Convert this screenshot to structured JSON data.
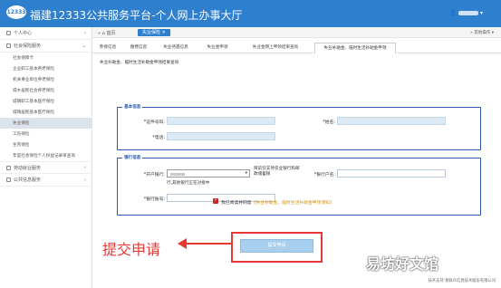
{
  "header": {
    "logo": "12333",
    "title": "福建12333公共服务平台-个人网上办事大厅",
    "user_caret": "▾"
  },
  "sidebar": {
    "groups": [
      {
        "label": "个人中心",
        "icon": "person-icon"
      },
      {
        "label": "社会保险服务",
        "icon": "shield-icon"
      }
    ],
    "items": [
      {
        "label": "社会保障卡"
      },
      {
        "label": "企业职工基本养老保险"
      },
      {
        "label": "机关事业单位养老保险"
      },
      {
        "label": "城乡居民社会养老保险"
      },
      {
        "label": "城镇职工基本医疗保险"
      },
      {
        "label": "城镇居民基本医疗保险"
      },
      {
        "label": "失业保险"
      },
      {
        "label": "工伤保险"
      },
      {
        "label": "生育保险"
      },
      {
        "label": "年度社会保险个人权益记录单查询"
      }
    ],
    "bottom": [
      {
        "label": "劳动就业服务",
        "icon": "briefcase-icon"
      },
      {
        "label": "公共信息服务",
        "icon": "info-icon"
      }
    ]
  },
  "crumb": {
    "home": "首页",
    "chip": "失业保险",
    "chip_close": "✕",
    "other": "其他操作"
  },
  "tabs": [
    {
      "label": "参保信息"
    },
    {
      "label": "缴费信息"
    },
    {
      "label": "失业待遇信息"
    },
    {
      "label": "失业金申领"
    },
    {
      "label": "失业金网上申领结果查询"
    },
    {
      "label": "失业补助金、临时生活补助金申领"
    }
  ],
  "subtab": "失业补助金、临时生活补助金申领结果查询",
  "basic": {
    "title": "基本信息",
    "id_label": "*证件号码:",
    "name_label": "*姓名:",
    "phone_label": "*电话:"
  },
  "bank": {
    "title": "银行信息",
    "bank_label": "*开户银行:",
    "select_caret": "▾",
    "note1": "目前仅支持农业银行和邮政储蓄银",
    "note2": "行,其他银行正在对接中",
    "holder_label": "*银行户名:",
    "account_label": "*银行账号:"
  },
  "agree": {
    "checkbox_mark": "✓",
    "prefix": "我已阅读并同意",
    "link": "《失业补助金、临时生活补助金申领须知》"
  },
  "submit_label": "提交申请",
  "annotation": "提交申请",
  "watermark": "易坊好文馆",
  "footer": "技术支持:易联众信息技术股份有限公司",
  "colors": {
    "topbar": "#2e7fce",
    "panel_border": "#2a5bb0",
    "annotation": "#e53935",
    "submit": "#a8cfee"
  }
}
